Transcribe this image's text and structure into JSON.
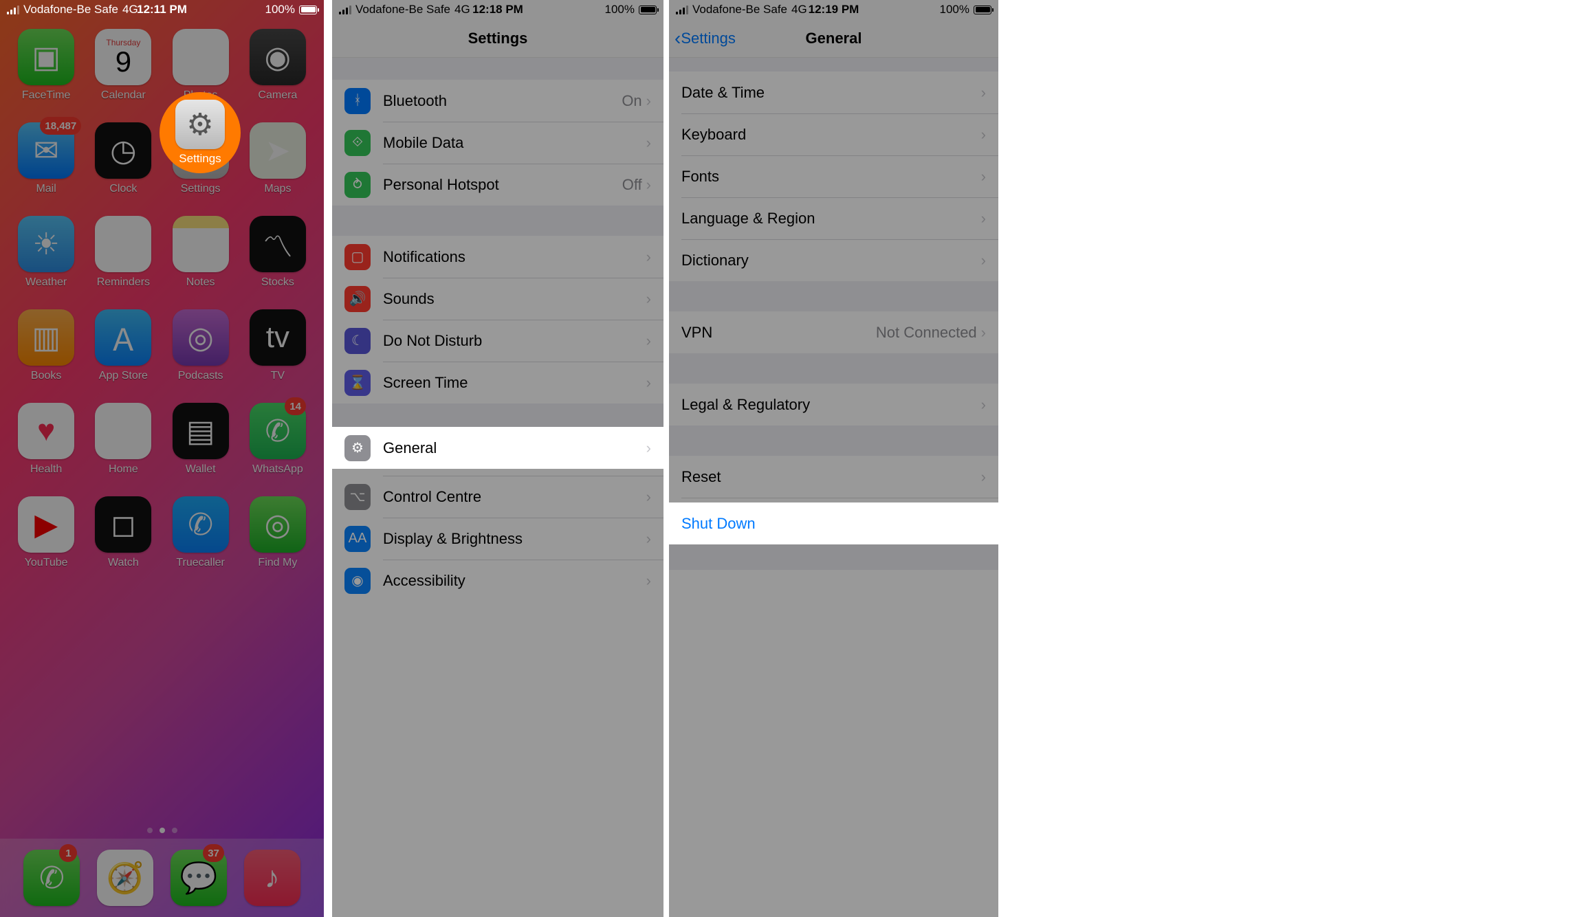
{
  "status": {
    "carrier": "Vodafone-Be Safe",
    "network": "4G",
    "battery": "100%",
    "time1": "12:11 PM",
    "time2": "12:18 PM",
    "time3": "12:19 PM"
  },
  "home": {
    "calendar_day": "Thursday",
    "calendar_date": "9",
    "apps": [
      {
        "name": "FaceTime"
      },
      {
        "name": "Calendar"
      },
      {
        "name": "Photos"
      },
      {
        "name": "Camera"
      },
      {
        "name": "Mail",
        "badge": "18,487"
      },
      {
        "name": "Clock"
      },
      {
        "name": "Settings"
      },
      {
        "name": "Maps"
      },
      {
        "name": "Weather"
      },
      {
        "name": "Reminders"
      },
      {
        "name": "Notes"
      },
      {
        "name": "Stocks"
      },
      {
        "name": "Books"
      },
      {
        "name": "App Store"
      },
      {
        "name": "Podcasts"
      },
      {
        "name": "TV"
      },
      {
        "name": "Health"
      },
      {
        "name": "Home"
      },
      {
        "name": "Wallet"
      },
      {
        "name": "WhatsApp",
        "badge": "14"
      },
      {
        "name": "YouTube"
      },
      {
        "name": "Watch"
      },
      {
        "name": "Truecaller"
      },
      {
        "name": "Find My"
      }
    ],
    "dock": [
      {
        "name": "Phone",
        "badge": "1"
      },
      {
        "name": "Safari"
      },
      {
        "name": "Messages",
        "badge": "37"
      },
      {
        "name": "Music"
      }
    ]
  },
  "settings": {
    "title": "Settings",
    "rows": {
      "bluetooth": "Bluetooth",
      "bt_val": "On",
      "mobile": "Mobile Data",
      "hotspot": "Personal Hotspot",
      "hs_val": "Off",
      "notifications": "Notifications",
      "sounds": "Sounds",
      "dnd": "Do Not Disturb",
      "screentime": "Screen Time",
      "general": "General",
      "control": "Control Centre",
      "display": "Display & Brightness",
      "accessibility": "Accessibility"
    }
  },
  "general": {
    "back": "Settings",
    "title": "General",
    "rows": {
      "date": "Date & Time",
      "keyboard": "Keyboard",
      "fonts": "Fonts",
      "lang": "Language & Region",
      "dict": "Dictionary",
      "vpn": "VPN",
      "vpn_val": "Not Connected",
      "legal": "Legal & Regulatory",
      "reset": "Reset",
      "shutdown": "Shut Down"
    }
  }
}
